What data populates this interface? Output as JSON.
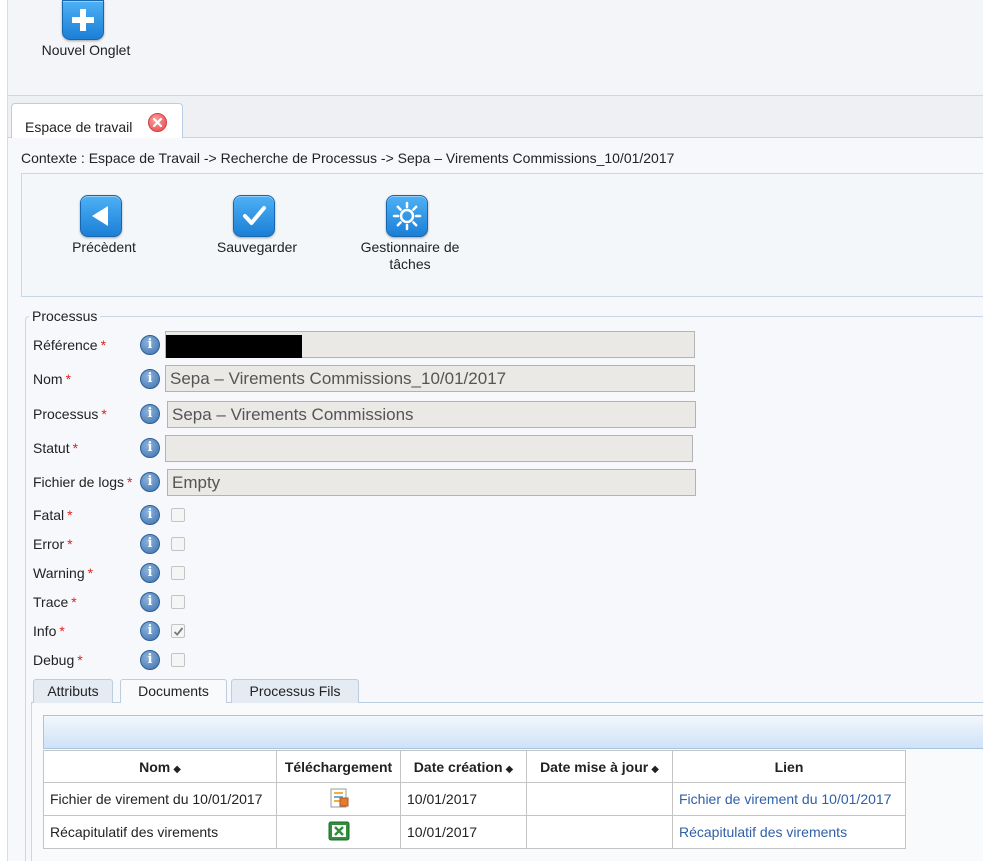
{
  "toolbar": {
    "new_tab_label": "Nouvel Onglet"
  },
  "tab": {
    "label": "Espace de travail"
  },
  "breadcrumb": "Contexte : Espace de Travail -> Recherche de Processus -> Sepa – Virements Commissions_10/01/2017",
  "actions": {
    "previous": "Précèdent",
    "save": "Sauvegarder",
    "task_manager_line1": "Gestionnaire de",
    "task_manager_line2": "tâches"
  },
  "form": {
    "legend": "Processus",
    "required_marker": "*",
    "fields": {
      "reference": {
        "label": "Référence",
        "value": ""
      },
      "nom": {
        "label": "Nom",
        "value": "Sepa – Virements Commissions_10/01/2017"
      },
      "processus": {
        "label": "Processus",
        "value": "Sepa – Virements Commissions"
      },
      "statut": {
        "label": "Statut",
        "value": ""
      },
      "logs": {
        "label": "Fichier de logs",
        "value": "Empty"
      }
    },
    "levels": [
      {
        "label": "Fatal",
        "checked": false
      },
      {
        "label": "Error",
        "checked": false
      },
      {
        "label": "Warning",
        "checked": false
      },
      {
        "label": "Trace",
        "checked": false
      },
      {
        "label": "Info",
        "checked": true
      },
      {
        "label": "Debug",
        "checked": false
      }
    ]
  },
  "subtabs": [
    "Attributs",
    "Documents",
    "Processus Fils"
  ],
  "documents": {
    "columns": {
      "nom": "Nom",
      "telechargement": "Téléchargement",
      "date_creation": "Date création",
      "date_maj": "Date mise à jour",
      "lien": "Lien"
    },
    "sort_glyph": "◆",
    "rows": [
      {
        "nom": "Fichier de virement du 10/01/2017",
        "icon": "document-icon",
        "date_creation": "10/01/2017",
        "date_maj": "",
        "lien": "Fichier de virement du 10/01/2017"
      },
      {
        "nom": "Récapitulatif des virements",
        "icon": "excel-icon",
        "date_creation": "10/01/2017",
        "date_maj": "",
        "lien": "Récapitulatif des virements"
      }
    ]
  },
  "colors": {
    "accent": "#1b7fd6",
    "link": "#2f5fa7",
    "required": "#dd2222"
  }
}
